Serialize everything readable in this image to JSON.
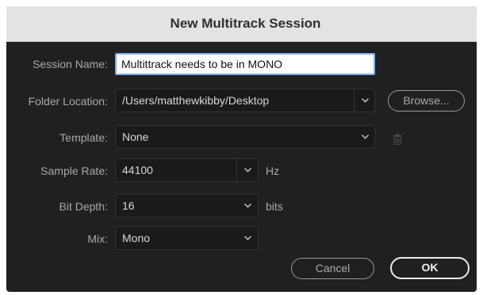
{
  "dialog": {
    "title": "New Multitrack Session"
  },
  "session_name": {
    "label": "Session Name:",
    "value": "Multittrack needs to be in MONO"
  },
  "folder_location": {
    "label": "Folder Location:",
    "value": "/Users/matthewkibby/Desktop",
    "browse_label": "Browse..."
  },
  "template": {
    "label": "Template:",
    "value": "None"
  },
  "sample_rate": {
    "label": "Sample Rate:",
    "value": "44100",
    "unit": "Hz"
  },
  "bit_depth": {
    "label": "Bit Depth:",
    "value": "16",
    "unit": "bits"
  },
  "mix": {
    "label": "Mix:",
    "value": "Mono"
  },
  "buttons": {
    "cancel": "Cancel",
    "ok": "OK"
  },
  "icons": {
    "dropdown": "chevron-down-icon",
    "delete_template": "trash-icon"
  },
  "colors": {
    "dialog_bg": "#202020",
    "titlebar_bg": "#e3e3e3",
    "focus": "#7aaef0"
  }
}
